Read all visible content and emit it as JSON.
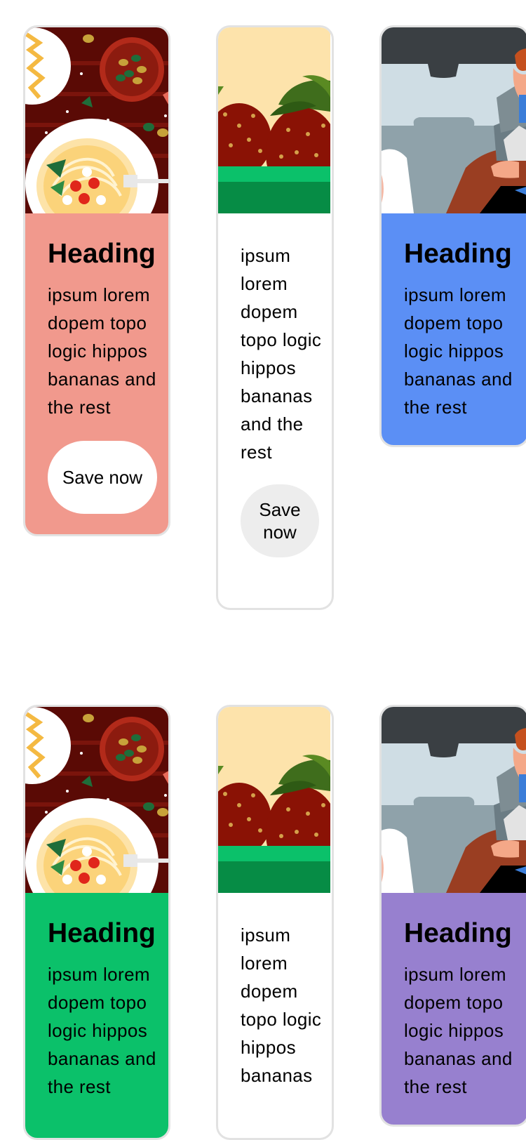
{
  "colors": {
    "coral": "#f1998d",
    "white": "#ffffff",
    "blue": "#5b8ff5",
    "green": "#0bc16a",
    "purple": "#9780cf",
    "button_light": "#ededed",
    "card_border": "#e2e2e2"
  },
  "cards": [
    {
      "image": "pasta-illustration",
      "heading": "Heading",
      "text": "ipsum lorem dopem topo logic hippos bananas and the rest",
      "button": "Save now",
      "background": "#f1998d"
    },
    {
      "image": "strawberry-illustration",
      "heading": "",
      "text": "ipsum lorem dopem topo logic hippos bananas and the rest",
      "button": "Save now",
      "background": "#ffffff"
    },
    {
      "image": "car-passenger-illustration",
      "heading": "Heading",
      "text": "ipsum lorem dopem topo logic hippos bananas and the rest",
      "button": "",
      "background": "#5b8ff5"
    },
    {
      "image": "pasta-illustration",
      "heading": "Heading",
      "text": "ipsum lorem dopem topo logic hippos bananas and the rest",
      "button": "",
      "background": "#0bc16a"
    },
    {
      "image": "strawberry-illustration",
      "heading": "",
      "text": "ipsum lorem dopem topo logic hippos bananas",
      "button": "",
      "background": "#ffffff"
    },
    {
      "image": "car-passenger-illustration",
      "heading": "Heading",
      "text": "ipsum lorem dopem topo logic hippos bananas and the rest",
      "button": "",
      "background": "#9780cf"
    }
  ]
}
